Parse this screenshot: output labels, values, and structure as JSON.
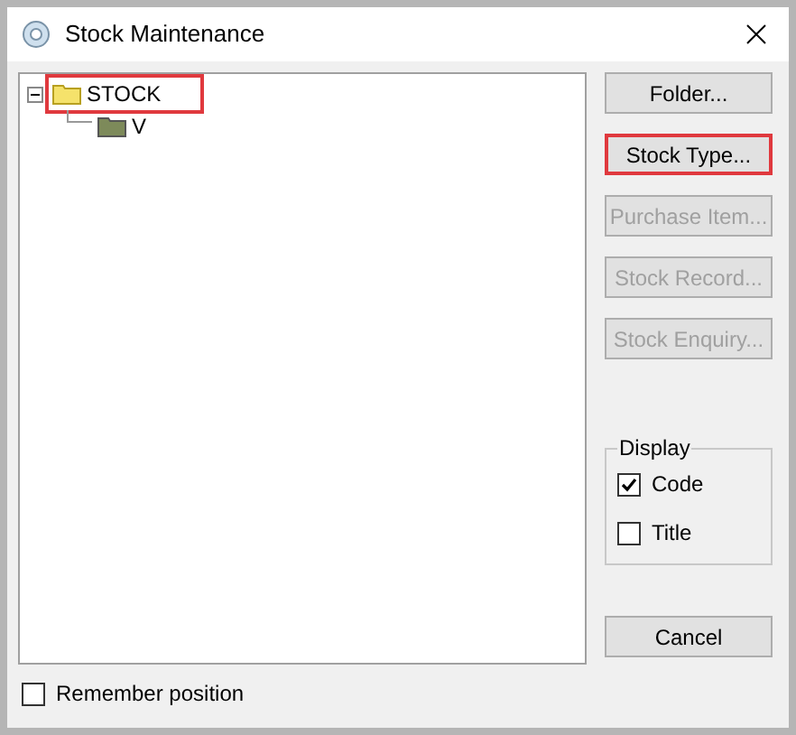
{
  "window": {
    "title": "Stock Maintenance"
  },
  "tree": [
    {
      "label": "STOCK",
      "expanded": true,
      "highlighted": true,
      "children": [
        {
          "label": "V",
          "highlighted": false
        }
      ]
    }
  ],
  "buttons": [
    {
      "label": "Folder...",
      "disabled": false,
      "highlighted": false
    },
    {
      "label": "Stock Type...",
      "disabled": false,
      "highlighted": true
    },
    {
      "label": "Purchase Item...",
      "disabled": true,
      "highlighted": false
    },
    {
      "label": "Stock Record...",
      "disabled": true,
      "highlighted": false
    },
    {
      "label": "Stock Enquiry...",
      "disabled": true,
      "highlighted": false
    }
  ],
  "display": {
    "title": "Display",
    "options": [
      {
        "label": "Code",
        "checked": true
      },
      {
        "label": "Title",
        "checked": false
      }
    ]
  },
  "cancel_button": {
    "label": "Cancel"
  },
  "remember_position": {
    "label": "Remember position",
    "checked": false
  }
}
